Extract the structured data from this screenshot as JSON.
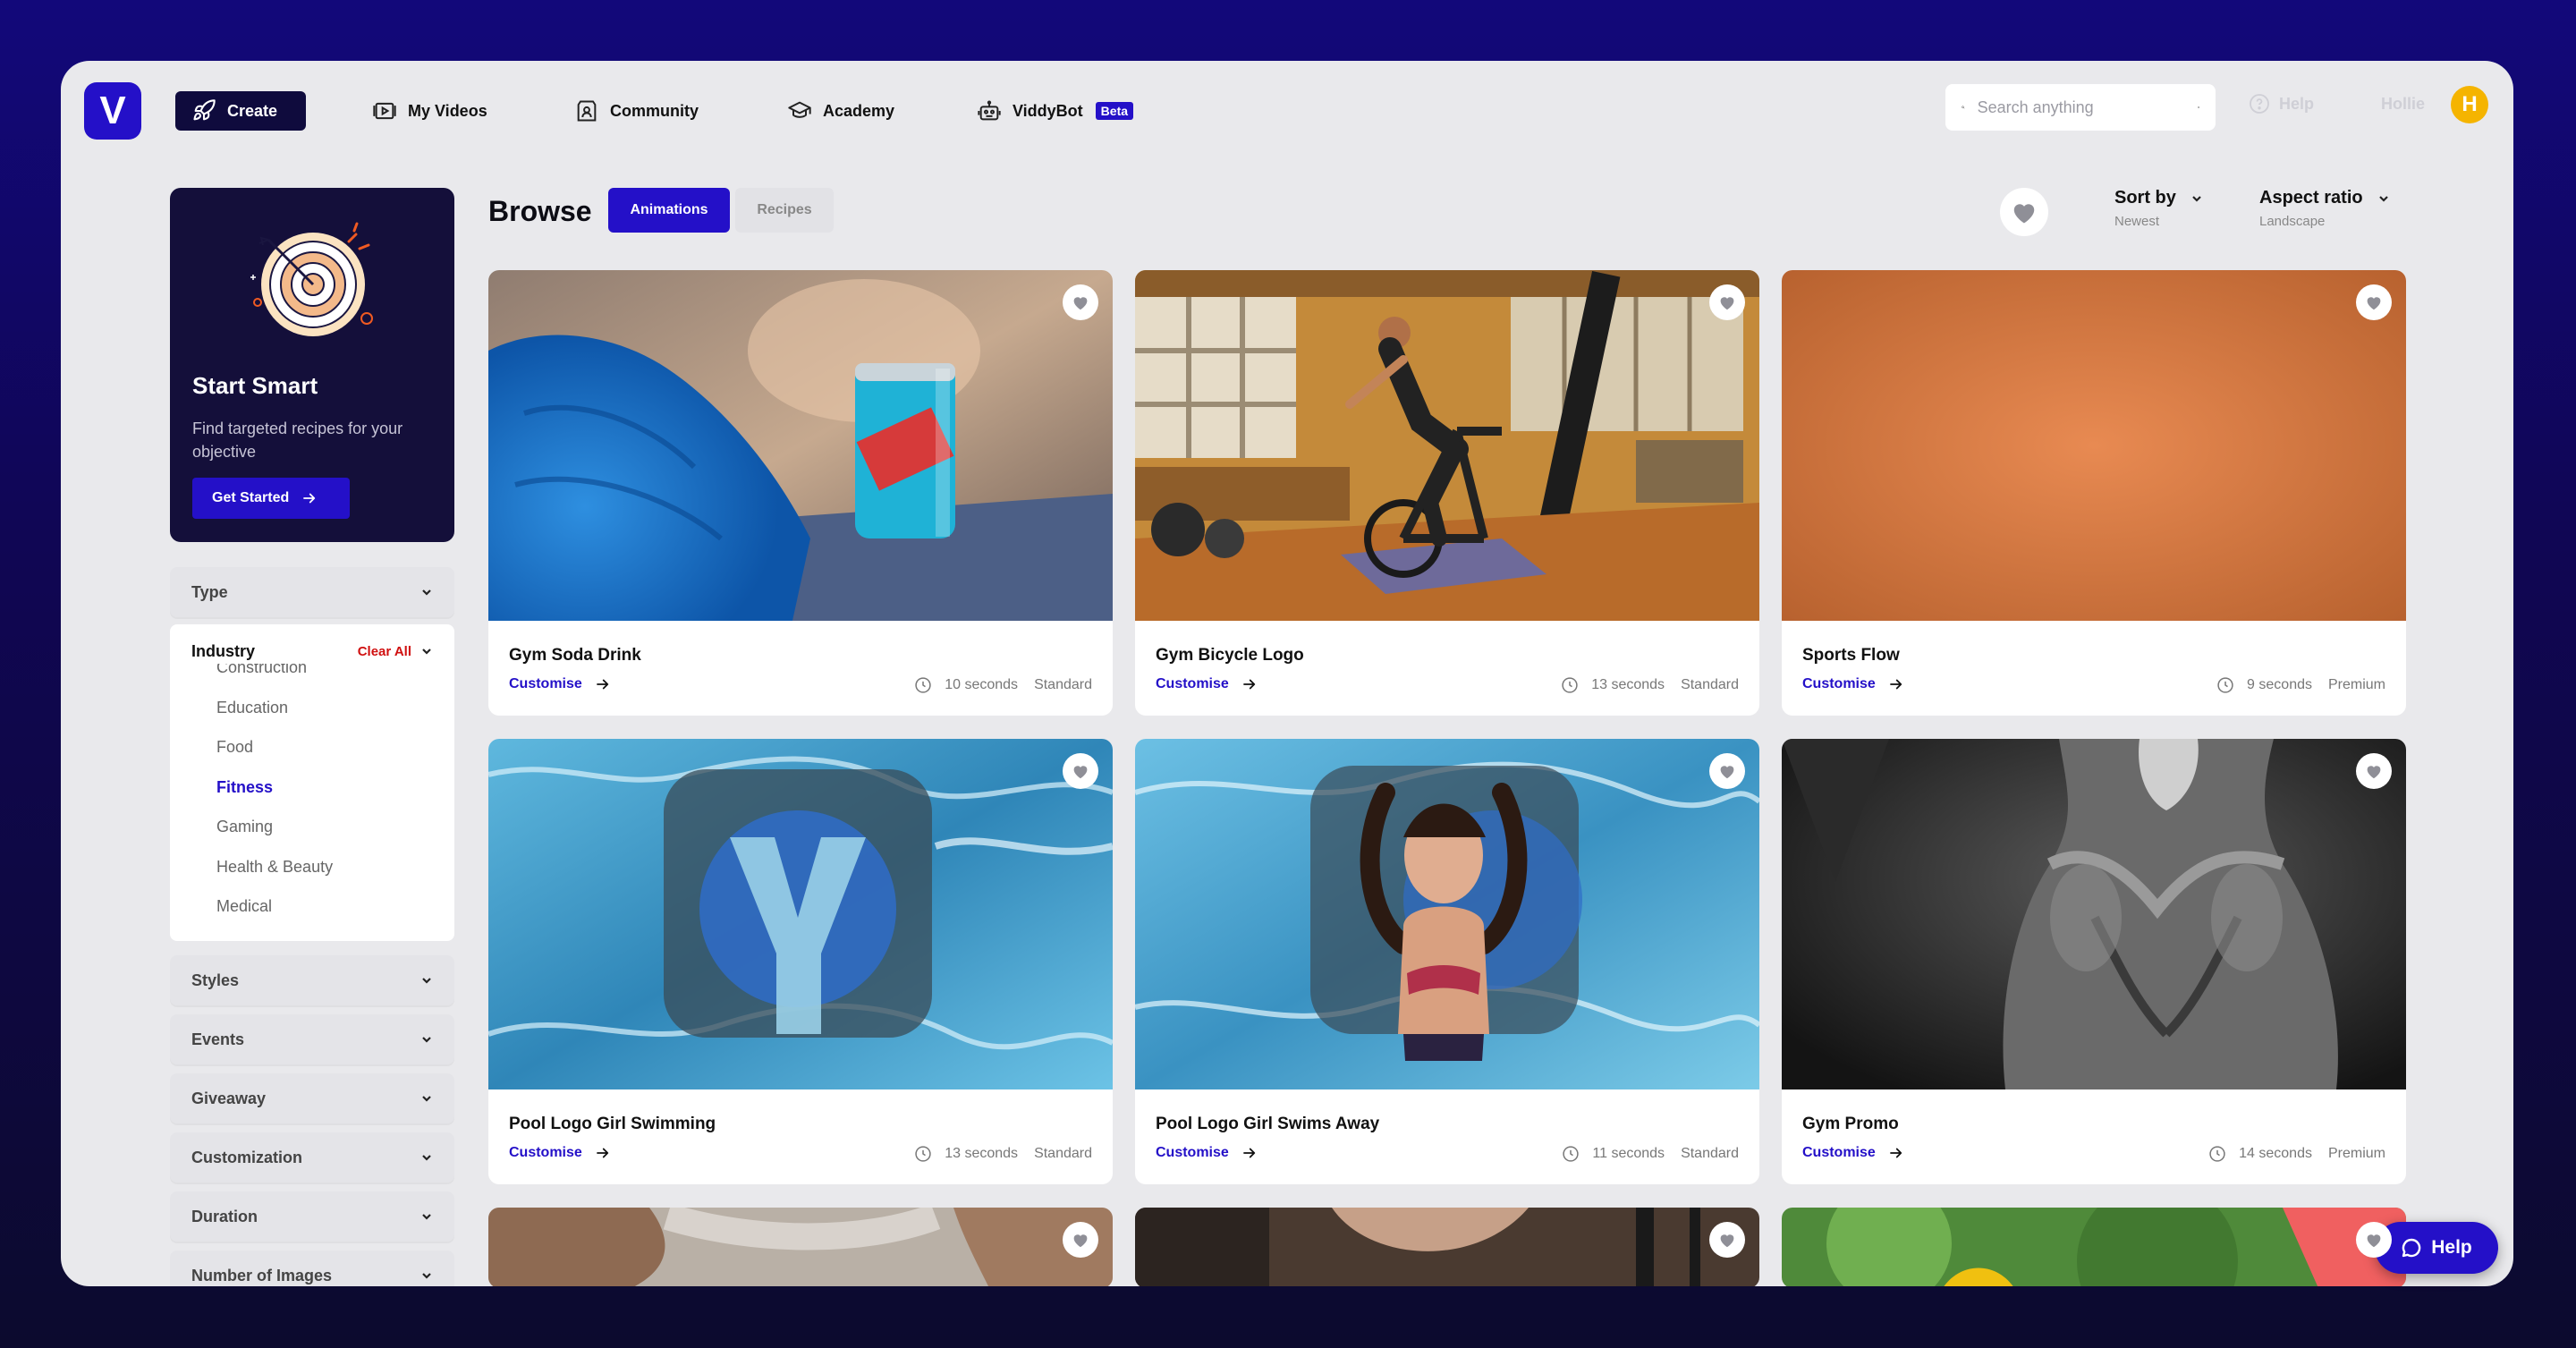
{
  "app": {
    "logo_letter": "V",
    "brand_color": "#2410c8"
  },
  "nav": {
    "create": "Create",
    "my_videos": "My Videos",
    "community": "Community",
    "academy": "Academy",
    "viddybot": "ViddyBot",
    "beta": "Beta"
  },
  "search": {
    "placeholder": "Search anything"
  },
  "header": {
    "help": "Help",
    "user_name": "Hollie",
    "avatar_letter": "H"
  },
  "promo": {
    "title": "Start Smart",
    "text": "Find targeted recipes for your objective",
    "button": "Get Started"
  },
  "filters": {
    "type": "Type",
    "industry": "Industry",
    "clear_all": "Clear All",
    "industry_options": [
      "Construction",
      "Education",
      "Food",
      "Fitness",
      "Gaming",
      "Health & Beauty",
      "Medical"
    ],
    "industry_selected": "Fitness",
    "styles": "Styles",
    "events": "Events",
    "giveaway": "Giveaway",
    "customization": "Customization",
    "duration": "Duration",
    "number_of_images": "Number of Images"
  },
  "browse": {
    "title": "Browse",
    "tab_animations": "Animations",
    "tab_recipes": "Recipes",
    "sort_label": "Sort by",
    "sort_value": "Newest",
    "aspect_label": "Aspect ratio",
    "aspect_value": "Landscape"
  },
  "cards": [
    {
      "title": "Gym Soda Drink",
      "action": "Customise",
      "duration": "10 seconds",
      "tier": "Standard"
    },
    {
      "title": "Gym Bicycle Logo",
      "action": "Customise",
      "duration": "13 seconds",
      "tier": "Standard"
    },
    {
      "title": "Sports Flow",
      "action": "Customise",
      "duration": "9 seconds",
      "tier": "Premium"
    },
    {
      "title": "Pool Logo Girl Swimming",
      "action": "Customise",
      "duration": "13 seconds",
      "tier": "Standard"
    },
    {
      "title": "Pool Logo Girl Swims Away",
      "action": "Customise",
      "duration": "11 seconds",
      "tier": "Standard"
    },
    {
      "title": "Gym Promo",
      "action": "Customise",
      "duration": "14 seconds",
      "tier": "Premium"
    }
  ],
  "help_button": "Help"
}
